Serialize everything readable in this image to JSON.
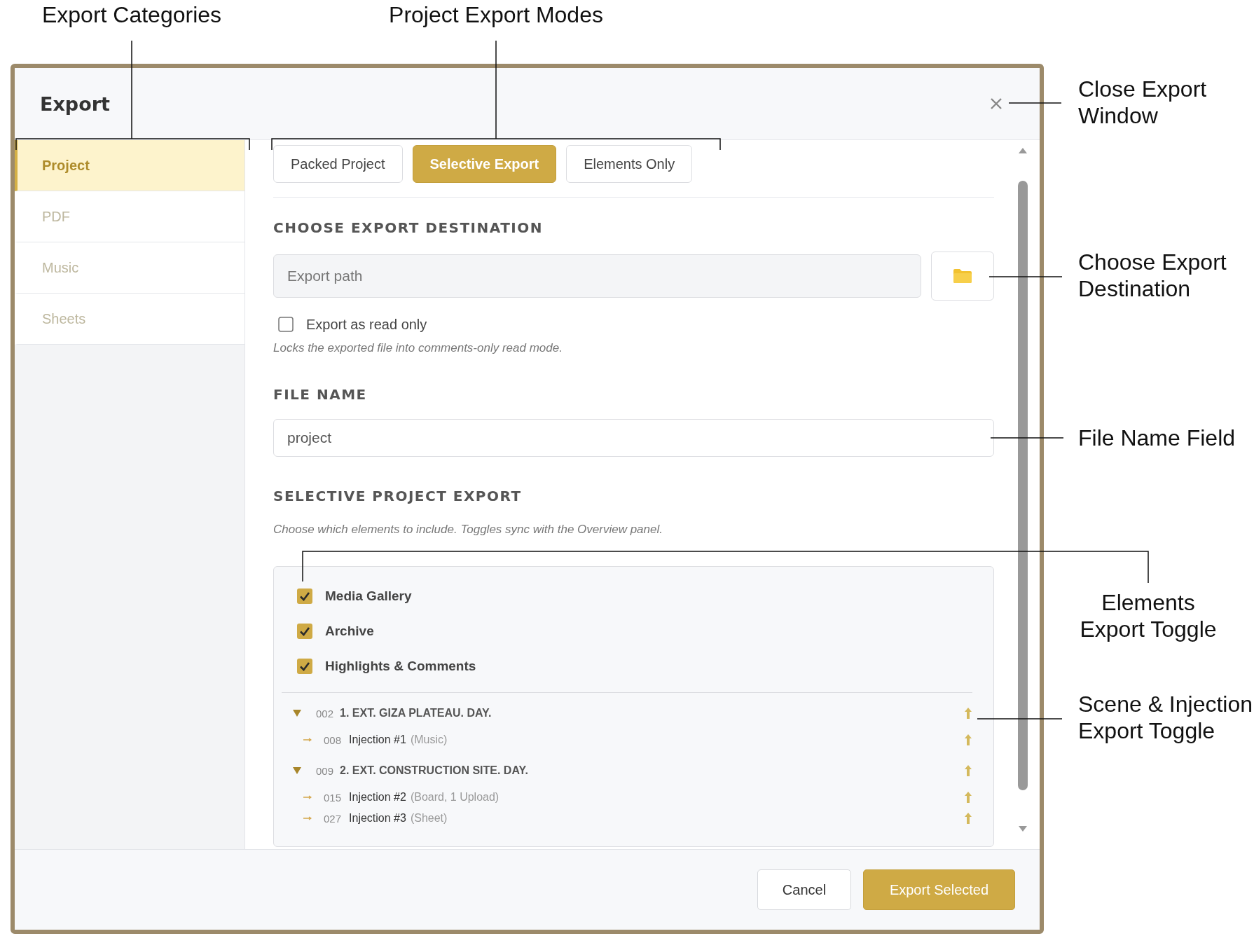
{
  "annotations": [
    {
      "text": "Export Categories"
    },
    {
      "text": "Project Export Modes"
    },
    {
      "text": "Close Export Window"
    },
    {
      "text": "Choose Export Destination"
    },
    {
      "text": "File Name Field"
    },
    {
      "text": "Elements Export Toggle"
    },
    {
      "text": "Scene & Injection Export Toggle"
    }
  ],
  "dialog": {
    "title": "Export"
  },
  "sidebar": {
    "items": [
      {
        "label": "Project",
        "selected": true
      },
      {
        "label": "PDF",
        "selected": false
      },
      {
        "label": "Music",
        "selected": false
      },
      {
        "label": "Sheets",
        "selected": false
      }
    ]
  },
  "tabs": [
    {
      "label": "Packed Project",
      "selected": false
    },
    {
      "label": "Selective Export",
      "selected": true
    },
    {
      "label": "Elements Only",
      "selected": false
    }
  ],
  "destination": {
    "heading": "CHOOSE EXPORT DESTINATION",
    "path": {
      "placeholder": "Export path"
    },
    "read_only": {
      "label": "Export as read only",
      "checked": false
    },
    "hint": "Locks the exported file into comments-only read mode."
  },
  "file_name": {
    "heading": "FILE NAME",
    "value": "project"
  },
  "selective": {
    "heading": "SELECTIVE PROJECT EXPORT",
    "hint": "Choose which elements to include. Toggles sync with the Overview panel.",
    "elements": [
      {
        "label": "Media Gallery",
        "checked": true
      },
      {
        "label": "Archive",
        "checked": true
      },
      {
        "label": "Highlights & Comments",
        "checked": true
      }
    ],
    "scenes": [
      {
        "number": "002",
        "title": "1. EXT. GIZA PLATEAU. DAY.",
        "expanded": true,
        "children": [
          {
            "number": "008",
            "title": "Injection #1",
            "detail": "(Music)"
          }
        ]
      },
      {
        "number": "009",
        "title": "2. EXT. CONSTRUCTION SITE. DAY.",
        "expanded": true,
        "children": [
          {
            "number": "015",
            "title": "Injection #2",
            "detail": "(Board, 1 Upload)"
          },
          {
            "number": "027",
            "title": "Injection #3",
            "detail": "(Sheet)"
          }
        ]
      }
    ]
  },
  "buttons": [
    {
      "label": "Cancel",
      "kind": "secondary"
    },
    {
      "label": "Export Selected",
      "kind": "primary"
    }
  ]
}
